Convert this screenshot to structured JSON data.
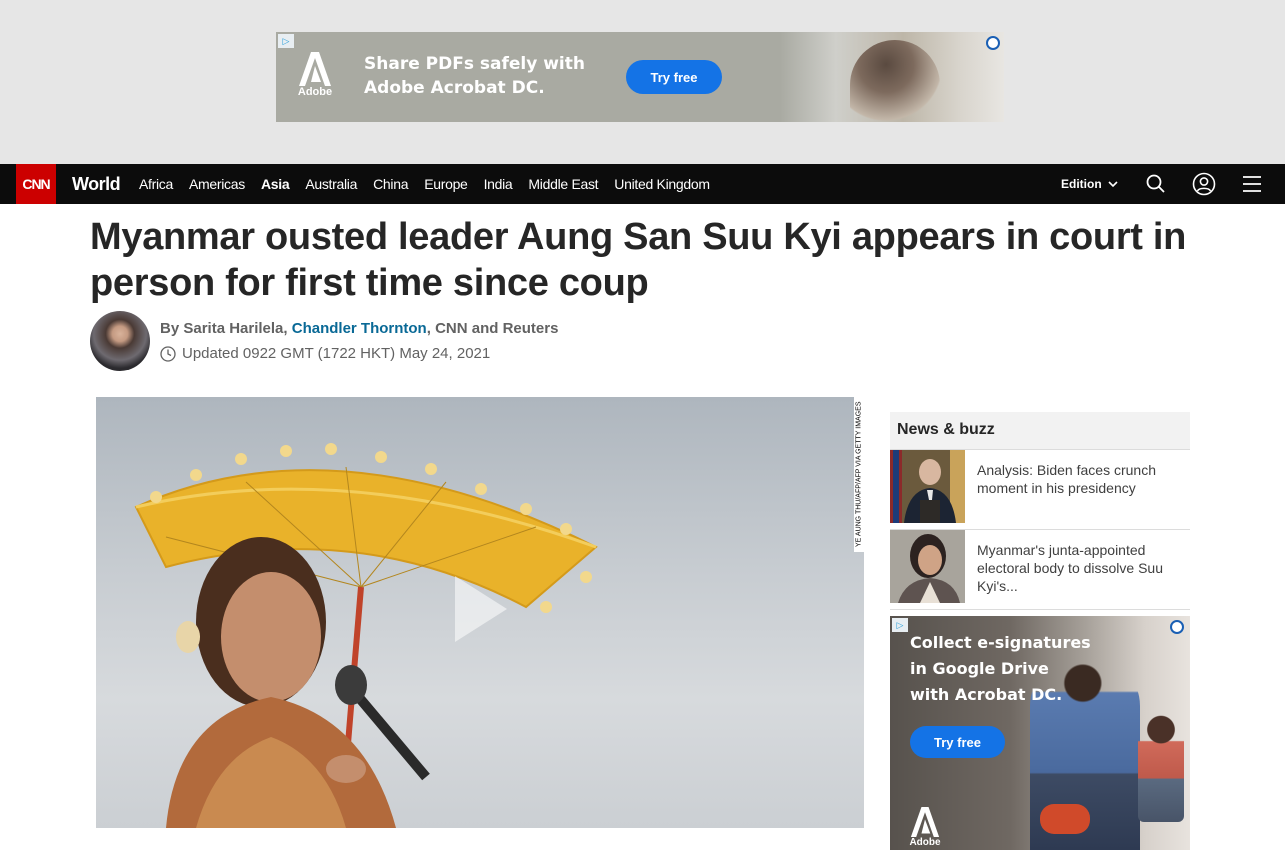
{
  "top_ad": {
    "adchoices": "▷",
    "brand": "Adobe",
    "message_line1": "Share PDFs safely with",
    "message_line2": "Adobe Acrobat DC.",
    "cta": "Try free"
  },
  "nav": {
    "logo": "CNN",
    "section": "World",
    "items": [
      {
        "label": "Africa",
        "active": false
      },
      {
        "label": "Americas",
        "active": false
      },
      {
        "label": "Asia",
        "active": true
      },
      {
        "label": "Australia",
        "active": false
      },
      {
        "label": "China",
        "active": false
      },
      {
        "label": "Europe",
        "active": false
      },
      {
        "label": "India",
        "active": false
      },
      {
        "label": "Middle East",
        "active": false
      },
      {
        "label": "United Kingdom",
        "active": false
      }
    ],
    "edition": "Edition",
    "icons": [
      "search-icon",
      "account-icon",
      "menu-icon"
    ]
  },
  "article": {
    "headline": "Myanmar ousted leader Aung San Suu Kyi appears in court in person for first time since coup",
    "byline_prefix": "By Sarita Harilela, ",
    "byline_link": "Chandler Thornton",
    "byline_suffix": ", CNN and Reuters",
    "timestamp": "Updated 0922 GMT (1722 HKT) May 24, 2021",
    "media_credit": "YE AUNG THU/AFP/AFP VIA GETTY IMAGES"
  },
  "sidebar": {
    "title": "News & buzz",
    "items": [
      {
        "text": "Analysis: Biden faces crunch moment in his presidency"
      },
      {
        "text": "Myanmar's junta-appointed electoral body to dissolve Suu Kyi's..."
      }
    ]
  },
  "side_ad": {
    "adchoices": "▷",
    "message_line1": "Collect e-signatures",
    "message_line2": "in Google Drive",
    "message_line3": "with Acrobat DC.",
    "cta": "Try free",
    "brand": "Adobe"
  },
  "colors": {
    "cnn_red": "#cc0000",
    "nav_bg": "#0c0c0c",
    "link_blue": "#096996",
    "adobe_blue": "#1473e6"
  }
}
